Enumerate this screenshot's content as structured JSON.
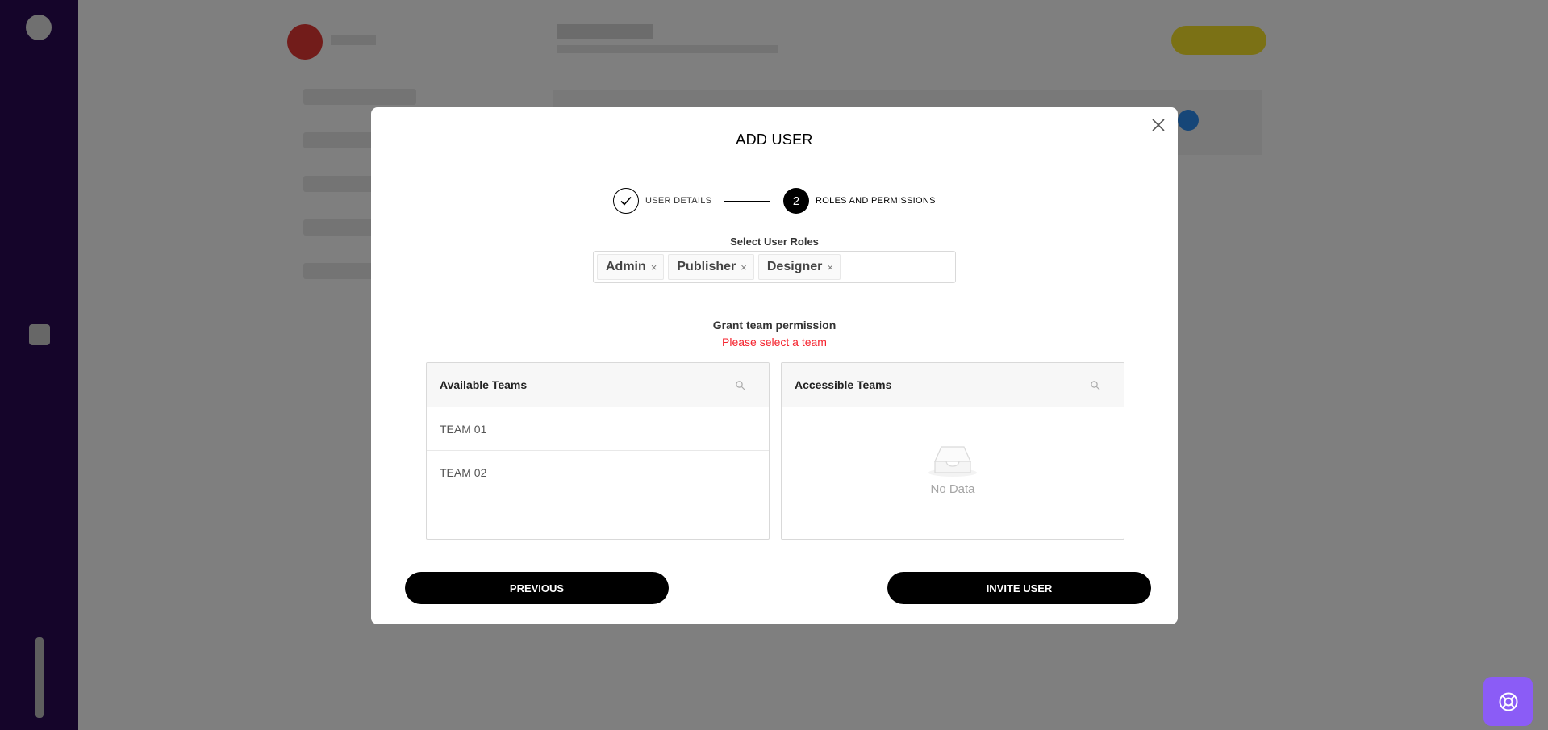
{
  "modal": {
    "title": "ADD USER",
    "stepper": {
      "step1_label": "USER DETAILS",
      "step2_number": "2",
      "step2_label": "ROLES AND PERMISSIONS"
    },
    "roles": {
      "label": "Select User Roles",
      "selected": [
        "Admin",
        "Publisher",
        "Designer"
      ],
      "remove_glyph": "×"
    },
    "grant": {
      "label": "Grant team permission",
      "error": "Please select a team"
    },
    "available_teams": {
      "title": "Available Teams",
      "items": [
        "TEAM 01",
        "TEAM 02"
      ]
    },
    "accessible_teams": {
      "title": "Accessible Teams",
      "empty_text": "No Data"
    },
    "buttons": {
      "previous": "PREVIOUS",
      "invite": "INVITE USER"
    }
  },
  "colors": {
    "overlay": "rgba(0,0,0,0.5)",
    "error": "#f5222d",
    "help_button": "#8b5cf6",
    "primary_button": "#000000"
  },
  "icons": [
    "check-icon",
    "close-icon",
    "search-icon",
    "empty-inbox-icon",
    "lifebuoy-icon"
  ]
}
